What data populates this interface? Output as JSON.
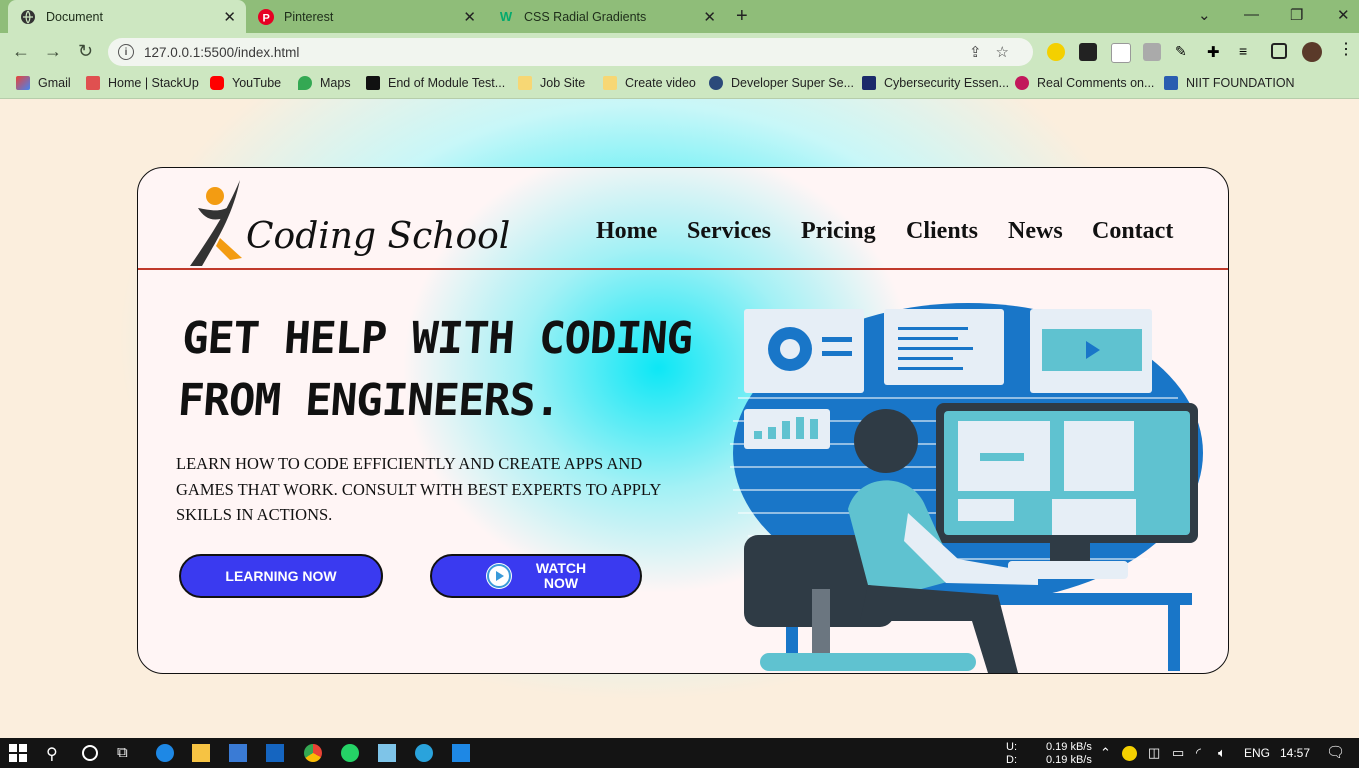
{
  "browser": {
    "tabs": [
      {
        "title": "Document",
        "active": true
      },
      {
        "title": "Pinterest",
        "active": false
      },
      {
        "title": "CSS Radial Gradients",
        "active": false
      }
    ],
    "url": "127.0.0.1:5500/index.html",
    "bookmarks": [
      "Gmail",
      "Home | StackUp",
      "YouTube",
      "Maps",
      "End of Module Test...",
      "Job Site",
      "Create video",
      "Developer Super Se...",
      "Cybersecurity Essen...",
      "Real Comments on...",
      "NIIT FOUNDATION"
    ]
  },
  "site": {
    "logo": "Coding School",
    "nav": [
      "Home",
      "Services",
      "Pricing",
      "Clients",
      "News",
      "Contact"
    ],
    "headline_1": "GET HELP WITH CODING",
    "headline_2": "FROM ENGINEERS.",
    "description": "LEARN HOW TO CODE EFFICIENTLY AND CREATE APPS AND GAMES THAT WORK. CONSULT WITH BEST EXPERTS TO APPLY SKILLS IN ACTIONS.",
    "cta_learning": "LEARNING NOW",
    "cta_watch_1": "WATCH",
    "cta_watch_2": "NOW",
    "accent": "#3a3af0"
  },
  "taskbar": {
    "net_u_label": "U:",
    "net_d_label": "D:",
    "net_u": "0.19 kB/s",
    "net_d": "0.19 kB/s",
    "lang": "ENG",
    "time": "14:57"
  }
}
